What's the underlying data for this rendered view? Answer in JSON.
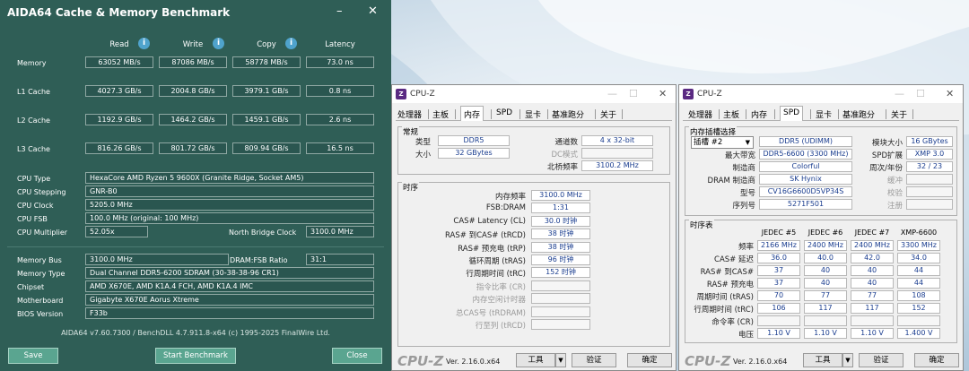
{
  "aida": {
    "title": "AIDA64 Cache & Memory Benchmark",
    "window_controls": [
      "–",
      "✕"
    ],
    "headers": [
      "Read",
      "Write",
      "Copy",
      "Latency"
    ],
    "rows": [
      {
        "label": "Memory",
        "read": "63052 MB/s",
        "write": "87086 MB/s",
        "copy": "58778 MB/s",
        "latency": "73.0 ns"
      },
      {
        "label": "L1 Cache",
        "read": "4027.3 GB/s",
        "write": "2004.8 GB/s",
        "copy": "3979.1 GB/s",
        "latency": "0.8 ns"
      },
      {
        "label": "L2 Cache",
        "read": "1192.9 GB/s",
        "write": "1464.2 GB/s",
        "copy": "1459.1 GB/s",
        "latency": "2.6 ns"
      },
      {
        "label": "L3 Cache",
        "read": "816.26 GB/s",
        "write": "801.72 GB/s",
        "copy": "809.94 GB/s",
        "latency": "16.5 ns"
      }
    ],
    "cpu": {
      "type_label": "CPU Type",
      "type": "HexaCore AMD Ryzen 5 9600X  (Granite Ridge, Socket AM5)",
      "stepping_label": "CPU Stepping",
      "stepping": "GNR-B0",
      "clock_label": "CPU Clock",
      "clock": "5205.0 MHz",
      "fsb_label": "CPU FSB",
      "fsb": "100.0 MHz  (original: 100 MHz)",
      "mult_label": "CPU Multiplier",
      "mult": "52.05x",
      "nb_label": "North Bridge Clock",
      "nb": "3100.0 MHz"
    },
    "mem": {
      "bus_label": "Memory Bus",
      "bus": "3100.0 MHz",
      "ratio_label": "DRAM:FSB Ratio",
      "ratio": "31:1",
      "type_label": "Memory Type",
      "type": "Dual Channel DDR5-6200 SDRAM  (30-38-38-96 CR1)",
      "chipset_label": "Chipset",
      "chipset": "AMD X670E, AMD K1A.4 FCH, AMD K1A.4 IMC",
      "mb_label": "Motherboard",
      "mb": "Gigabyte X670E Aorus Xtreme",
      "bios_label": "BIOS Version",
      "bios": "F33b"
    },
    "footer": "AIDA64 v7.60.7300 / BenchDLL 4.7.911.8-x64  (c) 1995-2025 FinalWire Ltd.",
    "buttons": {
      "save": "Save",
      "start": "Start Benchmark",
      "close": "Close"
    }
  },
  "cpuz_common": {
    "app": "CPU-Z",
    "tabs": [
      "处理器",
      "主板",
      "内存",
      "SPD",
      "显卡",
      "基准跑分",
      "关于"
    ],
    "version": "Ver. 2.16.0.x64",
    "tools": "工具",
    "validate": "验证",
    "ok": "确定",
    "arrow": "▼",
    "ctrl_min": "—",
    "ctrl_max": "☐",
    "ctrl_close": "✕"
  },
  "cpuz_mem": {
    "general_title": "常规",
    "type_label": "类型",
    "type": "DDR5",
    "size_label": "大小",
    "size": "32 GBytes",
    "channels_label": "通道数",
    "channels": "4 x 32-bit",
    "dc_label": "DC模式",
    "dc": "",
    "nb_label": "北桥频率",
    "nb": "3100.2 MHz",
    "timings_title": "时序",
    "timings": [
      {
        "label": "内存频率",
        "value": "3100.0 MHz",
        "dim": false
      },
      {
        "label": "FSB:DRAM",
        "value": "1:31",
        "dim": false
      },
      {
        "label": "CAS# Latency (CL)",
        "value": "30.0 时钟",
        "dim": false
      },
      {
        "label": "RAS# 到CAS# (tRCD)",
        "value": "38 时钟",
        "dim": false
      },
      {
        "label": "RAS# 预充电 (tRP)",
        "value": "38 时钟",
        "dim": false
      },
      {
        "label": "循环周期 (tRAS)",
        "value": "96 时钟",
        "dim": false
      },
      {
        "label": "行周期时间 (tRC)",
        "value": "152 时钟",
        "dim": false
      },
      {
        "label": "指令比率 (CR)",
        "value": "",
        "dim": true
      },
      {
        "label": "内存空闲计时器",
        "value": "",
        "dim": true
      },
      {
        "label": "总CAS号 (tRDRAM)",
        "value": "",
        "dim": true
      },
      {
        "label": "行至列 (tRCD)",
        "value": "",
        "dim": true
      }
    ]
  },
  "cpuz_spd": {
    "slot_title": "内存插槽选择",
    "slot": "插槽 #2",
    "module_type": "DDR5 (UDIMM)",
    "module_size_label": "模块大小",
    "module_size": "16 GBytes",
    "max_bw_label": "最大带宽",
    "max_bw": "DDR5-6600 (3300 MHz)",
    "spd_ext_label": "SPD扩展",
    "spd_ext": "XMP 3.0",
    "mfr_label": "制造商",
    "mfr": "Colorful",
    "week_label": "周次/年份",
    "week": "32 / 23",
    "dram_mfr_label": "DRAM 制造商",
    "dram_mfr": "SK Hynix",
    "buffer_label": "缓冲",
    "buffer": "",
    "part_label": "型号",
    "part": "CV16G6600D5VP34S",
    "check_label": "校验",
    "check": "",
    "serial_label": "序列号",
    "serial": "5271F501",
    "reg_label": "注册",
    "reg": "",
    "table_title": "时序表",
    "cols": [
      "JEDEC #5",
      "JEDEC #6",
      "JEDEC #7",
      "XMP-6600"
    ],
    "rows": [
      {
        "label": "频率",
        "vals": [
          "2166 MHz",
          "2400 MHz",
          "2400 MHz",
          "3300 MHz"
        ]
      },
      {
        "label": "CAS# 延迟",
        "vals": [
          "36.0",
          "40.0",
          "42.0",
          "34.0"
        ]
      },
      {
        "label": "RAS# 到CAS#",
        "vals": [
          "37",
          "40",
          "40",
          "44"
        ]
      },
      {
        "label": "RAS# 预充电",
        "vals": [
          "37",
          "40",
          "40",
          "44"
        ]
      },
      {
        "label": "周期时间 (tRAS)",
        "vals": [
          "70",
          "77",
          "77",
          "108"
        ]
      },
      {
        "label": "行周期时间 (tRC)",
        "vals": [
          "106",
          "117",
          "117",
          "152"
        ]
      },
      {
        "label": "命令率 (CR)",
        "vals": [
          "",
          "",
          "",
          ""
        ]
      },
      {
        "label": "电压",
        "vals": [
          "1.10 V",
          "1.10 V",
          "1.10 V",
          "1.400 V"
        ]
      }
    ]
  }
}
